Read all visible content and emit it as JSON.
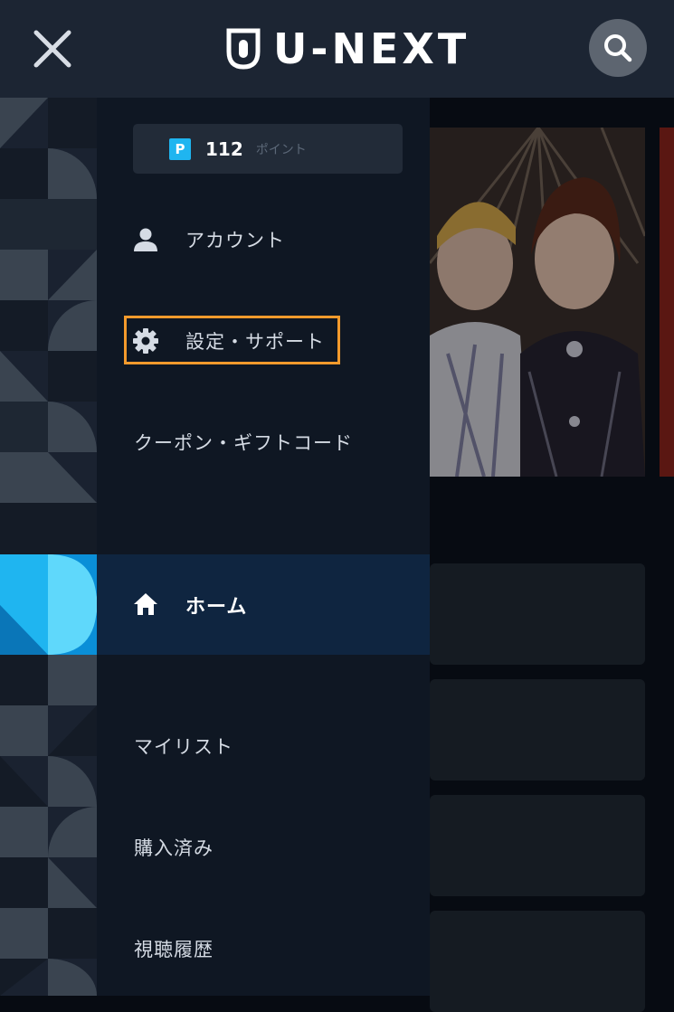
{
  "header": {
    "brand": "U-NEXT",
    "close_icon": "close-icon",
    "search_icon": "search-icon"
  },
  "menu": {
    "points": {
      "value": "112",
      "unit": "ポイント",
      "icon_letter": "P"
    },
    "items": [
      {
        "label": "アカウント",
        "icon": "person-icon"
      },
      {
        "label": "設定・サポート",
        "icon": "gear-icon",
        "highlighted": true
      },
      {
        "label": "クーポン・ギフトコード"
      }
    ],
    "home": {
      "label": "ホーム",
      "icon": "home-icon",
      "active": true
    },
    "library": [
      {
        "label": "マイリスト"
      },
      {
        "label": "購入済み"
      },
      {
        "label": "視聴履歴"
      }
    ]
  },
  "colors": {
    "header_bg": "#1c2533",
    "panel_bg": "#0f1723",
    "active_bg": "#0f2540",
    "highlight_border": "#f39a2c",
    "points_icon": "#1fb5f0"
  }
}
